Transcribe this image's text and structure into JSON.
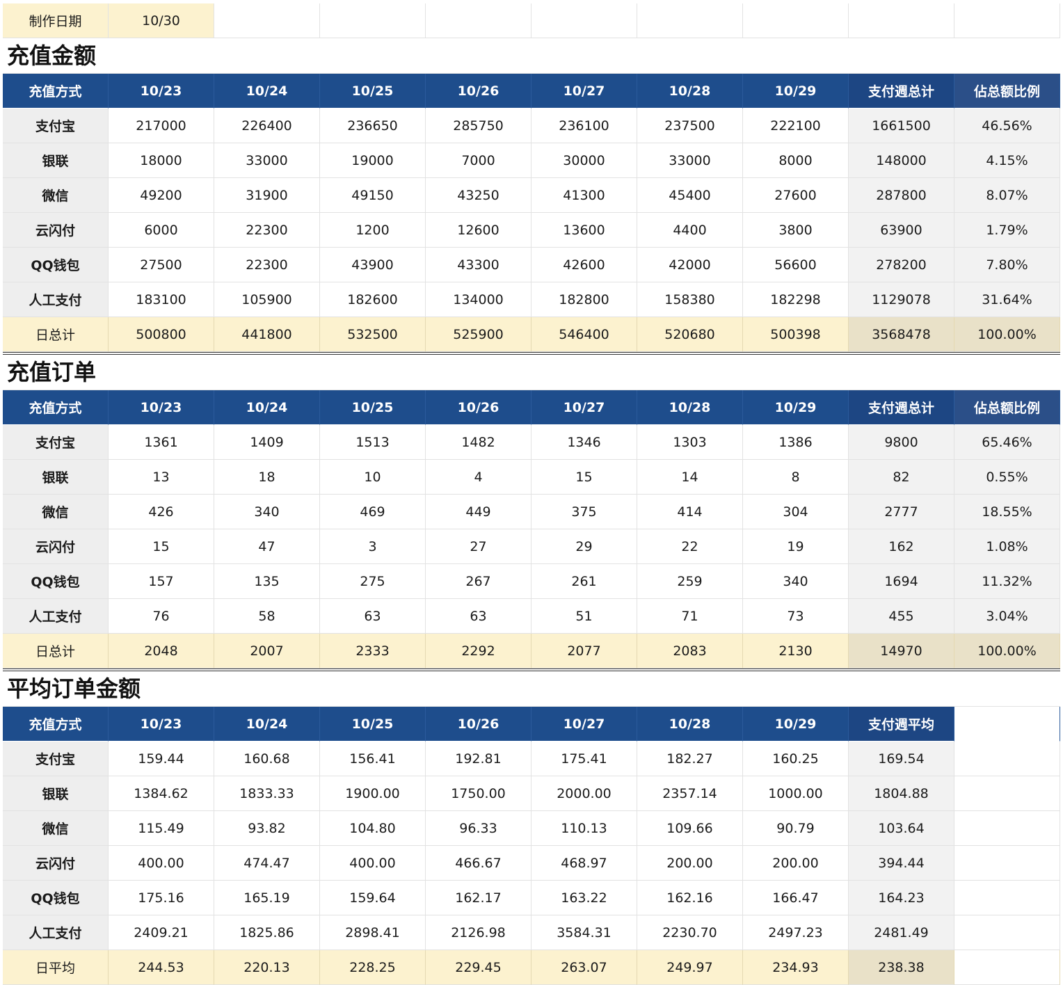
{
  "meta": {
    "date_label": "制作日期",
    "date_value": "10/30"
  },
  "sections": [
    {
      "title": "充值金额",
      "header": [
        "充值方式",
        "10/23",
        "10/24",
        "10/25",
        "10/26",
        "10/27",
        "10/28",
        "10/29",
        "支付週总计",
        "佔总额比例"
      ],
      "rows": [
        [
          "支付宝",
          "217000",
          "226400",
          "236650",
          "285750",
          "236100",
          "237500",
          "222100",
          "1661500",
          "46.56%"
        ],
        [
          "银联",
          "18000",
          "33000",
          "19000",
          "7000",
          "30000",
          "33000",
          "8000",
          "148000",
          "4.15%"
        ],
        [
          "微信",
          "49200",
          "31900",
          "49150",
          "43250",
          "41300",
          "45400",
          "27600",
          "287800",
          "8.07%"
        ],
        [
          "云闪付",
          "6000",
          "22300",
          "1200",
          "12600",
          "13600",
          "4400",
          "3800",
          "63900",
          "1.79%"
        ],
        [
          "QQ钱包",
          "27500",
          "22300",
          "43900",
          "43300",
          "42600",
          "42000",
          "56600",
          "278200",
          "7.80%"
        ],
        [
          "人工支付",
          "183100",
          "105900",
          "182600",
          "134000",
          "182800",
          "158380",
          "182298",
          "1129078",
          "31.64%"
        ]
      ],
      "summary": [
        "日总计",
        "500800",
        "441800",
        "532500",
        "525900",
        "546400",
        "520680",
        "500398",
        "3568478",
        "100.00%"
      ]
    },
    {
      "title": "充值订单",
      "header": [
        "充值方式",
        "10/23",
        "10/24",
        "10/25",
        "10/26",
        "10/27",
        "10/28",
        "10/29",
        "支付週总计",
        "佔总额比例"
      ],
      "rows": [
        [
          "支付宝",
          "1361",
          "1409",
          "1513",
          "1482",
          "1346",
          "1303",
          "1386",
          "9800",
          "65.46%"
        ],
        [
          "银联",
          "13",
          "18",
          "10",
          "4",
          "15",
          "14",
          "8",
          "82",
          "0.55%"
        ],
        [
          "微信",
          "426",
          "340",
          "469",
          "449",
          "375",
          "414",
          "304",
          "2777",
          "18.55%"
        ],
        [
          "云闪付",
          "15",
          "47",
          "3",
          "27",
          "29",
          "22",
          "19",
          "162",
          "1.08%"
        ],
        [
          "QQ钱包",
          "157",
          "135",
          "275",
          "267",
          "261",
          "259",
          "340",
          "1694",
          "11.32%"
        ],
        [
          "人工支付",
          "76",
          "58",
          "63",
          "63",
          "51",
          "71",
          "73",
          "455",
          "3.04%"
        ]
      ],
      "summary": [
        "日总计",
        "2048",
        "2007",
        "2333",
        "2292",
        "2077",
        "2083",
        "2130",
        "14970",
        "100.00%"
      ]
    },
    {
      "title": "平均订单金额",
      "header": [
        "充值方式",
        "10/23",
        "10/24",
        "10/25",
        "10/26",
        "10/27",
        "10/28",
        "10/29",
        "支付週平均"
      ],
      "rows": [
        [
          "支付宝",
          "159.44",
          "160.68",
          "156.41",
          "192.81",
          "175.41",
          "182.27",
          "160.25",
          "169.54"
        ],
        [
          "银联",
          "1384.62",
          "1833.33",
          "1900.00",
          "1750.00",
          "2000.00",
          "2357.14",
          "1000.00",
          "1804.88"
        ],
        [
          "微信",
          "115.49",
          "93.82",
          "104.80",
          "96.33",
          "110.13",
          "109.66",
          "90.79",
          "103.64"
        ],
        [
          "云闪付",
          "400.00",
          "474.47",
          "400.00",
          "466.67",
          "468.97",
          "200.00",
          "200.00",
          "394.44"
        ],
        [
          "QQ钱包",
          "175.16",
          "165.19",
          "159.64",
          "162.17",
          "163.22",
          "162.16",
          "166.47",
          "164.23"
        ],
        [
          "人工支付",
          "2409.21",
          "1825.86",
          "2898.41",
          "2126.98",
          "3584.31",
          "2230.70",
          "2497.23",
          "2481.49"
        ]
      ],
      "summary": [
        "日平均",
        "244.53",
        "220.13",
        "228.25",
        "229.45",
        "263.07",
        "249.97",
        "234.93",
        "238.38"
      ]
    }
  ]
}
